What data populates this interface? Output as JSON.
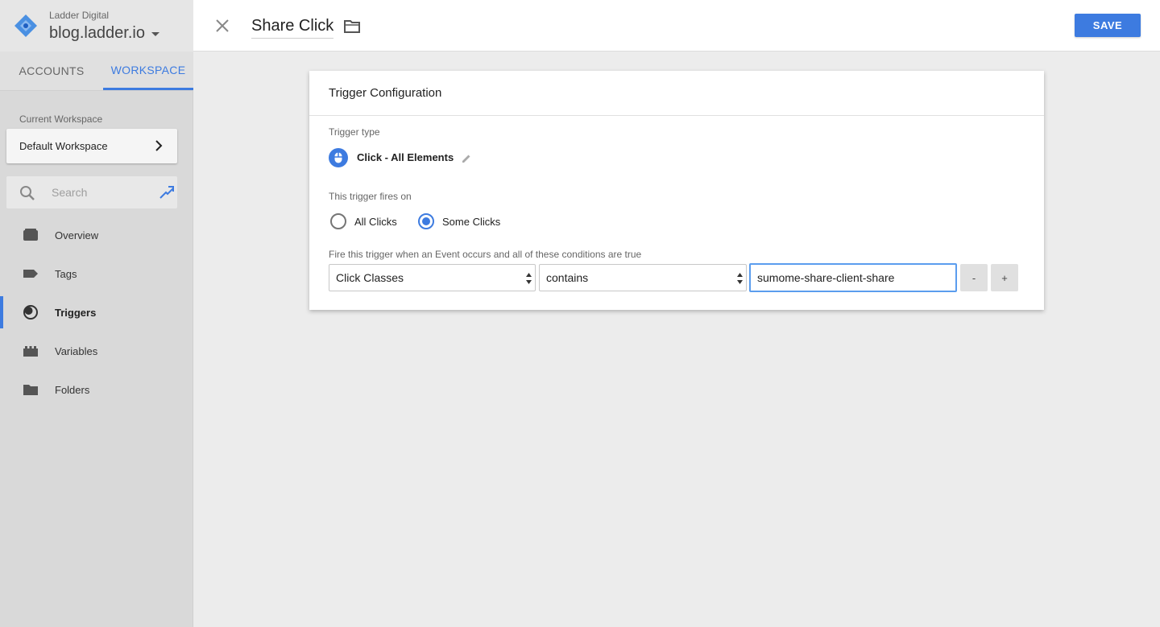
{
  "account": {
    "name": "Ladder Digital",
    "container": "blog.ladder.io"
  },
  "tabs": {
    "accounts": "ACCOUNTS",
    "workspace": "WORKSPACE"
  },
  "workspace": {
    "label": "Current Workspace",
    "name": "Default Workspace"
  },
  "search": {
    "placeholder": "Search"
  },
  "nav": {
    "items": [
      {
        "label": "Overview",
        "icon": "overview-icon"
      },
      {
        "label": "Tags",
        "icon": "tag-icon"
      },
      {
        "label": "Triggers",
        "icon": "triggers-icon",
        "active": true
      },
      {
        "label": "Variables",
        "icon": "variables-icon"
      },
      {
        "label": "Folders",
        "icon": "folder-icon"
      }
    ]
  },
  "header": {
    "title": "Share Click",
    "save_label": "SAVE"
  },
  "trigger": {
    "card_title": "Trigger Configuration",
    "type_label": "Trigger type",
    "type_name": "Click - All Elements",
    "fires_on_label": "This trigger fires on",
    "option_all": "All Clicks",
    "option_some": "Some Clicks",
    "selected_option": "Some Clicks",
    "conditions_label": "Fire this trigger when an Event occurs and all of these conditions are true",
    "condition": {
      "variable": "Click Classes",
      "operator": "contains",
      "value": "sumome-share-client-share"
    },
    "remove_label": "-",
    "add_label": "+"
  },
  "colors": {
    "accent": "#3d7be0",
    "logo": "#4a90e2"
  }
}
